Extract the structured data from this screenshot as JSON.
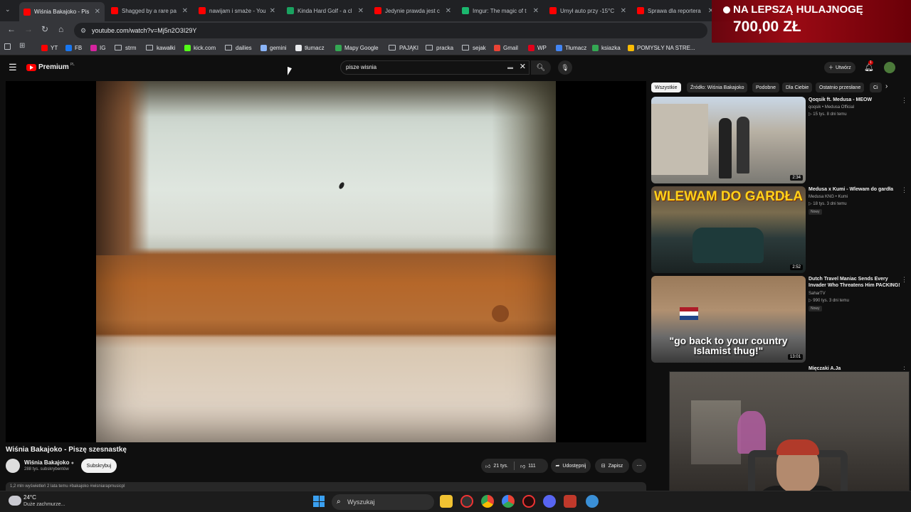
{
  "browser": {
    "tabs": [
      {
        "title": "Wiśnia Bakajoko - Pis",
        "favicon_color": "#ff0000",
        "active": true
      },
      {
        "title": "Shagged by a rare pa",
        "favicon_color": "#ff0000"
      },
      {
        "title": "nawijam i smaże - You",
        "favicon_color": "#ff0000"
      },
      {
        "title": "Kinda Hard Golf - a cl",
        "favicon_color": "#1aa260"
      },
      {
        "title": "Jedynie prawda jest c",
        "favicon_color": "#ff0000"
      },
      {
        "title": "Imgur: The magic of t",
        "favicon_color": "#1bb76e"
      },
      {
        "title": "Umył auto przy -15°C",
        "favicon_color": "#ff0000"
      },
      {
        "title": "Sprawa dla reportera",
        "favicon_color": "#ff0000"
      }
    ],
    "url": "youtube.com/watch?v=Mj5n2O3I29Y",
    "bookmarks": [
      {
        "label": "YT",
        "kind": "icon",
        "color": "#ff0000"
      },
      {
        "label": "FB",
        "kind": "icon",
        "color": "#1877f2"
      },
      {
        "label": "IG",
        "kind": "icon",
        "color": "#d6249f"
      },
      {
        "label": "strm",
        "kind": "folder"
      },
      {
        "label": "kawałki",
        "kind": "folder"
      },
      {
        "label": "kick.com",
        "kind": "icon",
        "color": "#53fc18"
      },
      {
        "label": "dailies",
        "kind": "folder"
      },
      {
        "label": "gemini",
        "kind": "icon",
        "color": "#8ab4f8"
      },
      {
        "label": "tłumacz",
        "kind": "icon",
        "color": "#e8eaed"
      },
      {
        "label": "Mapy Google",
        "kind": "icon",
        "color": "#34a853"
      },
      {
        "label": "PAJĄKI",
        "kind": "folder"
      },
      {
        "label": "pracka",
        "kind": "folder"
      },
      {
        "label": "sejak",
        "kind": "folder"
      },
      {
        "label": "Gmail",
        "kind": "icon",
        "color": "#ea4335"
      },
      {
        "label": "WP",
        "kind": "icon",
        "color": "#e2001a"
      },
      {
        "label": "Tłumacz",
        "kind": "icon",
        "color": "#4285f4"
      },
      {
        "label": "ksiazka",
        "kind": "icon",
        "color": "#34a853"
      },
      {
        "label": "POMYSŁY NA STRE...",
        "kind": "icon",
        "color": "#fbbc04"
      }
    ]
  },
  "youtube": {
    "logo_text": "Premium",
    "logo_sup": "PL",
    "search_value": "pisze wisnia",
    "create_label": "Utwórz",
    "notif_count": "1"
  },
  "video": {
    "title": "Wiśnia Bakajoko - Piszę szesnastkę",
    "channel": "Wiśnia Bakajoko",
    "subscribers": "288 tys. subskrybentów",
    "subscribe_label": "Subskrybuj",
    "likes": "21 tys.",
    "dislikes": "111",
    "share_label": "Udostępnij",
    "save_label": "Zapisz",
    "desc_peek": "1,2 mln wyświetleń  2 lata temu  #bakajoko #wisniarapmusicpl"
  },
  "chips": [
    "Wszystkie",
    "Źródło: Wiśnia Bakajoko",
    "Podobne",
    "Dla Ciebie",
    "Ostatnio przesłane",
    "Ci"
  ],
  "recommendations": [
    {
      "title": "Qoqsik ft. Medusa - MEOW",
      "channel": "qoqsik • Medusa Official",
      "meta": "▷ 15 tys.  8 dni temu",
      "duration": "2:34",
      "badge": ""
    },
    {
      "title": "Medusa x Kumi - Wlewam do gardła",
      "channel": "Medusa KNG • Kumi",
      "meta": "▷ 18 tys.  3 dni temu",
      "duration": "2:52",
      "badge": "Nowy"
    },
    {
      "title": "Dutch Travel Maniac Sends Every Invader Who Threatens Him PACKING!",
      "channel": "SaharTV",
      "meta": "▷ 990 tys.  3 dni temu",
      "duration": "13:01",
      "badge": "Nowy",
      "caption": "\"go back to your country Islamist thug!\""
    },
    {
      "title": "Mięczaki A.Ja",
      "channel": "",
      "meta": "",
      "duration": "",
      "badge": ""
    }
  ],
  "overlay": {
    "promo_line1": "NA LEPSZĄ HULAJNOGĘ",
    "promo_line2": "700,00 ZŁ"
  },
  "thumb2_title": "WLEWAM DO GARDŁA",
  "taskbar": {
    "temp": "24°C",
    "weather": "Duże zachmurze...",
    "search_placeholder": "Wyszukaj"
  }
}
